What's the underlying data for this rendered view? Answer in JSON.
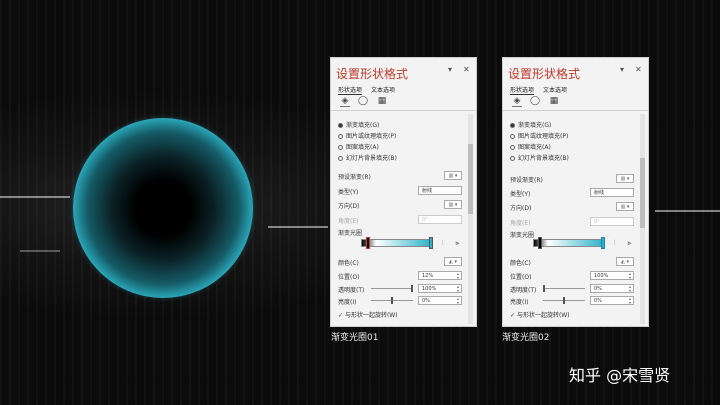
{
  "panels": [
    {
      "title": "设置形状格式",
      "controls": {
        "dropdown": "▾",
        "close": "✕"
      },
      "tabs": [
        "形状选项",
        "文本选项"
      ],
      "icons": [
        "fill-line-icon",
        "effects-icon",
        "size-properties-icon"
      ],
      "fill_options": [
        "渐变填充(G)",
        "图片或纹理填充(P)",
        "图案填充(A)",
        "幻灯片背景填充(B)"
      ],
      "fields": {
        "preset": "预设渐变(R)",
        "type": "类型(Y)",
        "type_value": "射线",
        "direction": "方向(D)",
        "angle": "角度(E)",
        "angle_value": "0°",
        "gradient_stops": "渐变光圈",
        "color": "颜色(C)",
        "position": "位置(O)",
        "position_value": "12%",
        "transparency": "透明度(T)",
        "transparency_value": "100%",
        "brightness": "亮度(I)",
        "brightness_value": "0%",
        "rotate_with_shape": "与形状一起旋转(W)"
      },
      "caption": "渐变光圈01"
    },
    {
      "title": "设置形状格式",
      "controls": {
        "dropdown": "▾",
        "close": "✕"
      },
      "tabs": [
        "形状选项",
        "文本选项"
      ],
      "icons": [
        "fill-line-icon",
        "effects-icon",
        "size-properties-icon"
      ],
      "fill_options": [
        "渐变填充(G)",
        "图片或纹理填充(P)",
        "图案填充(A)",
        "幻灯片背景填充(B)"
      ],
      "fields": {
        "preset": "预设渐变(R)",
        "type": "类型(Y)",
        "type_value": "射线",
        "direction": "方向(D)",
        "angle": "角度(E)",
        "angle_value": "0°",
        "gradient_stops": "渐变光圈",
        "color": "颜色(C)",
        "position": "位置(O)",
        "position_value": "100%",
        "transparency": "透明度(T)",
        "transparency_value": "0%",
        "brightness": "亮度(I)",
        "brightness_value": "0%",
        "rotate_with_shape": "与形状一起旋转(W)"
      },
      "caption": "渐变光圈02"
    }
  ],
  "brand": "知乎 @宋雪贤",
  "colors": {
    "title_red": "#c0392b",
    "sphere_cyan": "#2aa6b8",
    "gradient_end": "#2ab3c9"
  }
}
